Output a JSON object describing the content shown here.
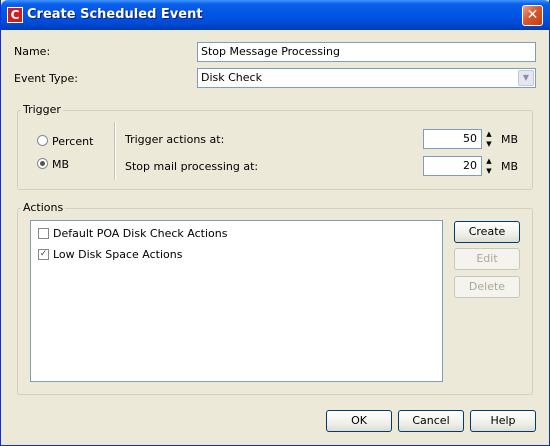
{
  "window": {
    "title": "Create Scheduled Event",
    "app_icon_letter": "C",
    "close_glyph": "✕"
  },
  "form": {
    "name_label": "Name:",
    "name_value": "Stop Message Processing",
    "event_type_label": "Event Type:",
    "event_type_value": "Disk Check"
  },
  "trigger": {
    "group_label": "Trigger",
    "unit_options": [
      {
        "label": "Percent",
        "selected": false
      },
      {
        "label": "MB",
        "selected": true
      }
    ],
    "actions_at_label": "Trigger actions at:",
    "actions_at_value": "50",
    "actions_at_unit": "MB",
    "stop_mail_label": "Stop mail processing at:",
    "stop_mail_value": "20",
    "stop_mail_unit": "MB"
  },
  "actions": {
    "group_label": "Actions",
    "items": [
      {
        "label": "Default POA Disk Check Actions",
        "checked": false
      },
      {
        "label": "Low Disk Space Actions",
        "checked": true
      }
    ],
    "create_label": "Create",
    "edit_label": "Edit",
    "delete_label": "Delete"
  },
  "footer": {
    "ok_label": "OK",
    "cancel_label": "Cancel",
    "help_label": "Help"
  },
  "colors": {
    "titlebar": "#0055e5",
    "dialog_background": "#ece9d8",
    "close_button": "#d7582f"
  }
}
